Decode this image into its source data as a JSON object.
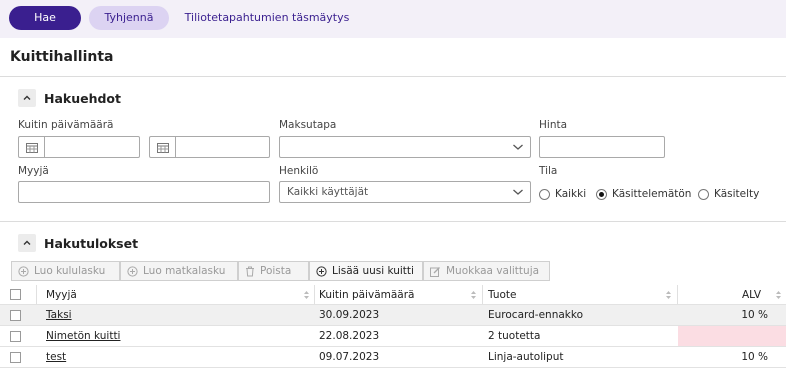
{
  "topbar": {
    "search_label": "Hae",
    "clear_label": "Tyhjennä",
    "match_label": "Tiliotetapahtumien täsmäytys"
  },
  "page": {
    "title": "Kuittihallinta"
  },
  "search_section": {
    "title": "Hakuehdot",
    "receipt_date_label": "Kuitin päivämäärä",
    "payment_method_label": "Maksutapa",
    "price_label": "Hinta",
    "seller_label": "Myyjä",
    "person_label": "Henkilö",
    "person_value": "Kaikki käyttäjät",
    "status_label": "Tila",
    "status_options": [
      "Kaikki",
      "Käsittelemätön",
      "Käsitelty"
    ],
    "status_selected": "Käsittelemätön"
  },
  "results_section": {
    "title": "Hakutulokset",
    "toolbar": {
      "create_expense": "Luo kululasku",
      "create_travel": "Luo matkalasku",
      "delete": "Poista",
      "add_receipt": "Lisää uusi kuitti",
      "edit_selected": "Muokkaa valittuja"
    },
    "columns": [
      "Myyjä",
      "Kuitin päivämäärä",
      "Tuote",
      "ALV"
    ],
    "rows": [
      {
        "seller": "Taksi",
        "date": "30.09.2023",
        "product": "Eurocard-ennakko",
        "vat": "10 %"
      },
      {
        "seller": "Nimetön kuitti",
        "date": "22.08.2023",
        "product": "2 tuotetta",
        "vat": ""
      },
      {
        "seller": "test",
        "date": "09.07.2023",
        "product": "Linja-autoliput",
        "vat": "10 %"
      }
    ]
  },
  "colors": {
    "primary": "#3a1f8f",
    "secondary": "#dcd3f2",
    "topbar_bg": "#f3f0f8",
    "row_highlight": "#f0f0f0",
    "missing_vat": "#fbdde3"
  },
  "icons": [
    "calendar-icon",
    "chevron-down-icon",
    "chevron-up-icon",
    "plus-circle-icon",
    "trash-icon",
    "edit-icon",
    "sort-icon"
  ]
}
